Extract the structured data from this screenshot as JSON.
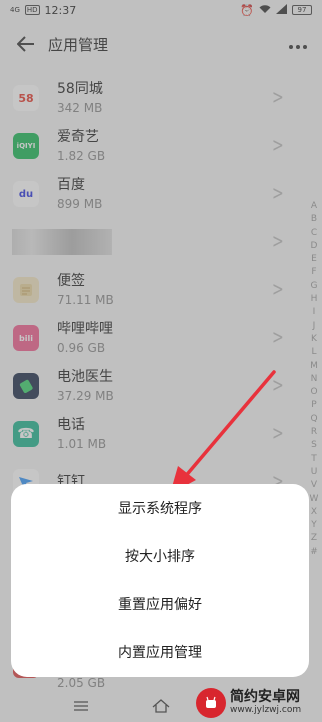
{
  "status_bar": {
    "time": "12:37",
    "network": "4G",
    "network_sub": "HD",
    "battery": "97"
  },
  "header": {
    "title": "应用管理"
  },
  "apps": [
    {
      "name": "58同城",
      "size": "342 MB",
      "icon_color": "#e73a2d",
      "icon_text": "58"
    },
    {
      "name": "爱奇艺",
      "size": "1.82 GB",
      "icon_color": "#19b955",
      "icon_text": "iQIYI"
    },
    {
      "name": "百度",
      "size": "899 MB",
      "icon_color": "#ffffff",
      "icon_text": "du"
    },
    {
      "name": "便签",
      "size": "71.11 MB",
      "icon_color": "#f3e6c2",
      "icon_text": ""
    },
    {
      "name": "哔哩哔哩",
      "size": "0.96 GB",
      "icon_color": "#f25d8e",
      "icon_text": "bili"
    },
    {
      "name": "电池医生",
      "size": "37.29 MB",
      "icon_color": "#1e2e4a",
      "icon_text": ""
    },
    {
      "name": "电话",
      "size": "1.01 MB",
      "icon_color": "#1fb58f",
      "icon_text": "☎"
    },
    {
      "name": "钉钉",
      "size": "",
      "icon_color": "#3296fa",
      "icon_text": ""
    },
    {
      "name": "",
      "size": "2.05 GB",
      "icon_color": "#e04040",
      "icon_text": ""
    }
  ],
  "alpha_index": [
    "A",
    "B",
    "C",
    "D",
    "E",
    "F",
    "G",
    "H",
    "I",
    "J",
    "K",
    "L",
    "M",
    "N",
    "O",
    "P",
    "Q",
    "R",
    "S",
    "T",
    "U",
    "V",
    "W",
    "X",
    "Y",
    "Z",
    "#"
  ],
  "sheet": {
    "items": [
      "显示系统程序",
      "按大小排序",
      "重置应用偏好",
      "内置应用管理"
    ]
  },
  "nav": {
    "menu_icon": "menu-icon",
    "home_icon": "home-icon"
  },
  "watermark": {
    "title": "简约安卓网",
    "url": "www.jylzwj.com"
  },
  "colors": {
    "overlay": "rgba(120,120,120,0.42)",
    "arrow": "#e8323c",
    "sheet_bg": "#ffffff"
  }
}
